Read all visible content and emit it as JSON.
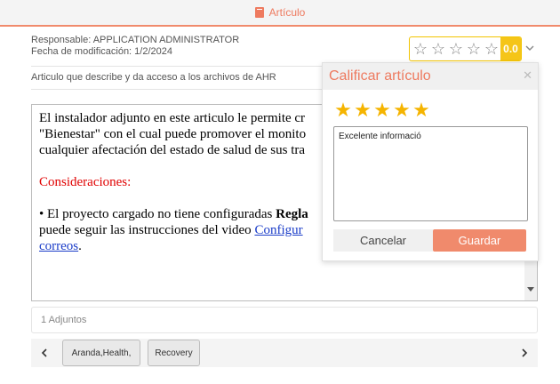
{
  "header": {
    "tab_label": "Artículo",
    "tab_icon": "book-icon",
    "accent_color": "#ee7a5f"
  },
  "article": {
    "responsible": "Responsable: APPLICATION ADMINISTRATOR",
    "modified": "Fecha de modificación: 1/2/2024",
    "description": "Articulo que describe y da acceso a los archivos de AHR"
  },
  "rating": {
    "stars": [
      "☆",
      "☆",
      "☆",
      "☆",
      "☆"
    ],
    "score": "0.0",
    "expand_icon": "chevron-down-icon",
    "color": "#f5c518"
  },
  "editor": {
    "line1": "El instalador adjunto en este articulo le permite cr",
    "line2": "\"Bienestar\" con el cual puede promover el monito",
    "line3": "cualquier afectación del estado de salud de sus tra",
    "considerations": "Consideraciones:",
    "bullet_start": "• El proyecto cargado no tiene configuradas ",
    "bullet_bold": "Regla",
    "line5_start": "puede seguir las instrucciones del  video ",
    "link1": "Configur",
    "link2": "correos",
    "period": "."
  },
  "attachments": {
    "label": "1 Adjuntos"
  },
  "tags": {
    "prev_icon": "chevron-left-icon",
    "next_icon": "chevron-right-icon",
    "items": [
      "Aranda,Health,",
      "Recovery"
    ]
  },
  "popup": {
    "title": "Calificar artículo",
    "close_icon": "close-icon",
    "stars": [
      "★",
      "★",
      "★",
      "★",
      "★"
    ],
    "comment": "Excelente informació",
    "cancel_label": "Cancelar",
    "save_label": "Guardar",
    "star_color": "#f5b400"
  }
}
